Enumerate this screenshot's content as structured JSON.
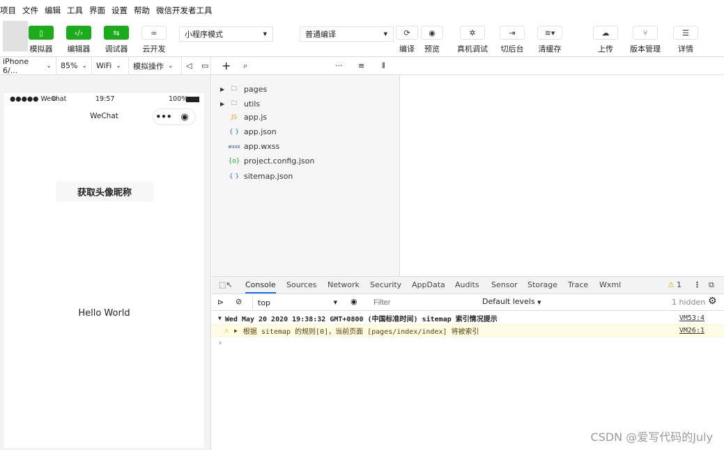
{
  "menubar": {
    "items": [
      "项目",
      "文件",
      "编辑",
      "工具",
      "界面",
      "设置",
      "帮助",
      "微信开发者工具"
    ]
  },
  "toolbar": {
    "simulator": "模拟器",
    "editor": "编辑器",
    "debugger": "调试器",
    "cloud": "云开发",
    "mode_select": "小程序模式",
    "compile_select": "普通编译",
    "compile": "编译",
    "preview": "预览",
    "real_debug": "真机调试",
    "background": "切后台",
    "clear_cache": "清缓存",
    "upload": "上传",
    "version": "版本管理",
    "details": "详情"
  },
  "subbar": {
    "device": "iPhone 6/...",
    "zoom": "85%",
    "network": "WiFi",
    "simulate_ops": "模拟操作"
  },
  "phone": {
    "carrier": "●●●●● WeChat",
    "time": "19:57",
    "battery": "100%",
    "nav_title": "WeChat",
    "button": "获取头像昵称",
    "hello": "Hello World"
  },
  "files": [
    {
      "name": "pages",
      "type": "folder"
    },
    {
      "name": "utils",
      "type": "folder"
    },
    {
      "name": "app.js",
      "type": "js"
    },
    {
      "name": "app.json",
      "type": "json"
    },
    {
      "name": "app.wxss",
      "type": "wxss"
    },
    {
      "name": "project.config.json",
      "type": "config"
    },
    {
      "name": "sitemap.json",
      "type": "json"
    }
  ],
  "devtools": {
    "tabs": [
      "Console",
      "Sources",
      "Network",
      "Security",
      "AppData",
      "Audits",
      "Sensor",
      "Storage",
      "Trace",
      "Wxml"
    ],
    "active_tab": "Console",
    "warning_count": "1",
    "context": "top",
    "filter_placeholder": "Filter",
    "levels": "Default levels",
    "hidden": "1 hidden"
  },
  "console": [
    {
      "text": "Wed May 20 2020 19:38:32 GMT+0800 (中国标准时间) sitemap 索引情况提示",
      "source": "VM53:4",
      "level": "info"
    },
    {
      "text": "根据 sitemap 的规则[0]，当前页面 [pages/index/index] 将被索引",
      "source": "VM26:1",
      "level": "warning"
    }
  ],
  "watermark": "CSDN @爱写代码的July",
  "colors": {
    "green": "#1aad19",
    "tab_active": "#1a73e8",
    "warning_bg": "#fffbe5"
  }
}
